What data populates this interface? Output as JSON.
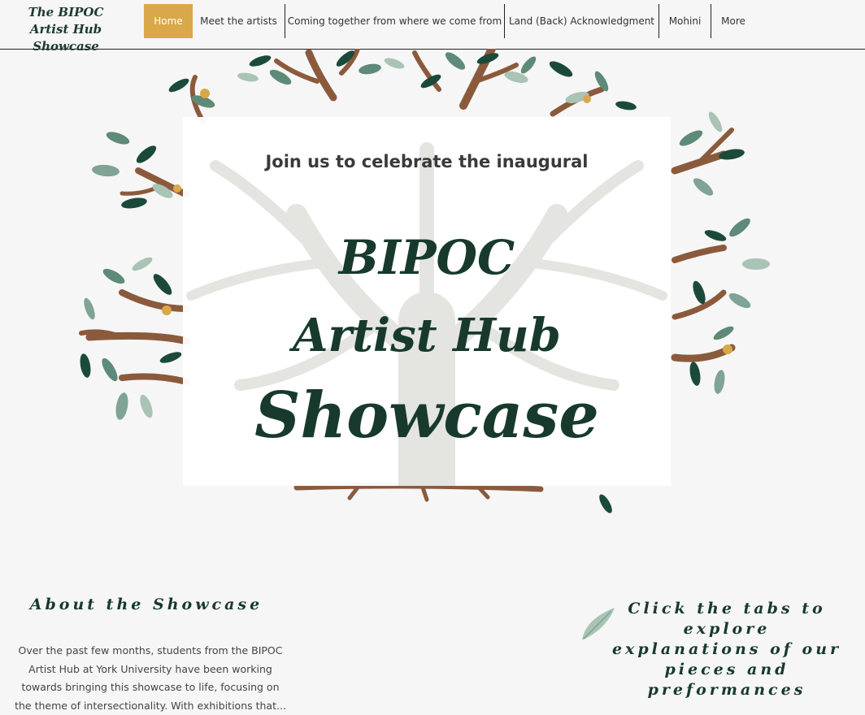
{
  "site": {
    "logo_line1": "The BIPOC",
    "logo_line2": "Artist Hub Showcase"
  },
  "nav": {
    "items": [
      {
        "label": "Home",
        "active": true
      },
      {
        "label": "Meet the artists"
      },
      {
        "label": "Coming together from where we come from"
      },
      {
        "label": "Land (Back) Acknowledgment"
      },
      {
        "label": "Mohini"
      },
      {
        "label": "More"
      }
    ]
  },
  "hero": {
    "kicker": "Join us to celebrate the inaugural",
    "title_line1": "BIPOC",
    "title_line2": "Artist Hub",
    "title_line3": "Showcase",
    "image_icon": "tree-illustration"
  },
  "about": {
    "heading": "About the Showcase",
    "body": "Over the past few months, students from the BIPOC Artist Hub at York University have been working towards bringing this showcase to life, focusing on the theme of intersectionality. With exhibitions that..."
  },
  "tabs_note": {
    "heading": "Click the tabs to explore explanations of our pieces and preformances",
    "icon": "leaf-icon"
  },
  "colors": {
    "accent": "#d9a849",
    "title_green": "#173a2c",
    "branch_brown": "#8b5a3c",
    "leaf_dark": "#1c4a3a",
    "leaf_mid": "#5e8a78",
    "leaf_light": "#a9c3b5",
    "background": "#f6f6f6"
  }
}
